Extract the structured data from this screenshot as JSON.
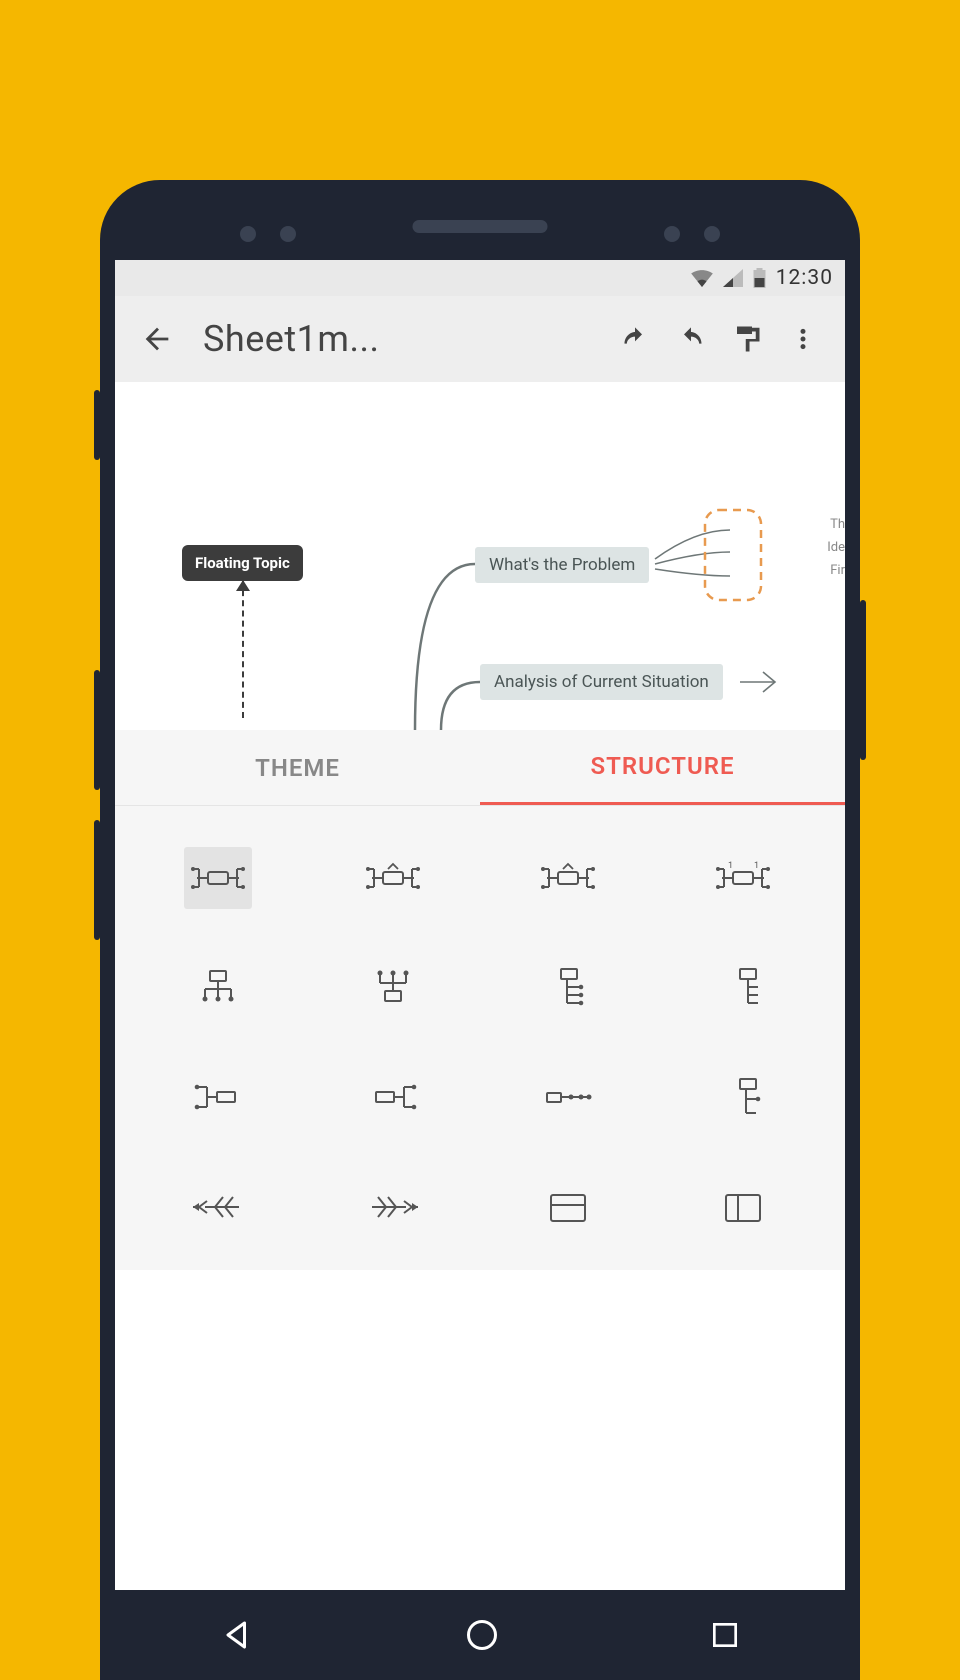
{
  "status": {
    "time": "12:30"
  },
  "appbar": {
    "title": "Sheet1m..."
  },
  "tabs": {
    "theme": "THEME",
    "structure": "STRUCTURE",
    "active": "structure"
  },
  "canvas": {
    "floating_topic": "Floating Topic",
    "node1": "What's the Problem",
    "node2": "Analysis of Current Situation",
    "sub1": "Th",
    "sub2": "Ide",
    "sub3": "Fir"
  },
  "structures": [
    {
      "id": "map-balanced",
      "selected": true
    },
    {
      "id": "map-clockwise",
      "selected": false
    },
    {
      "id": "map-ccw",
      "selected": false
    },
    {
      "id": "map-radial",
      "selected": false
    },
    {
      "id": "org-down",
      "selected": false
    },
    {
      "id": "org-up",
      "selected": false
    },
    {
      "id": "tree-right",
      "selected": false
    },
    {
      "id": "tree-right-alt",
      "selected": false
    },
    {
      "id": "logic-right",
      "selected": false
    },
    {
      "id": "logic-left",
      "selected": false
    },
    {
      "id": "timeline-right",
      "selected": false
    },
    {
      "id": "tree-down",
      "selected": false
    },
    {
      "id": "fishbone-left",
      "selected": false
    },
    {
      "id": "fishbone-right",
      "selected": false
    },
    {
      "id": "spreadsheet",
      "selected": false
    },
    {
      "id": "matrix",
      "selected": false
    }
  ]
}
